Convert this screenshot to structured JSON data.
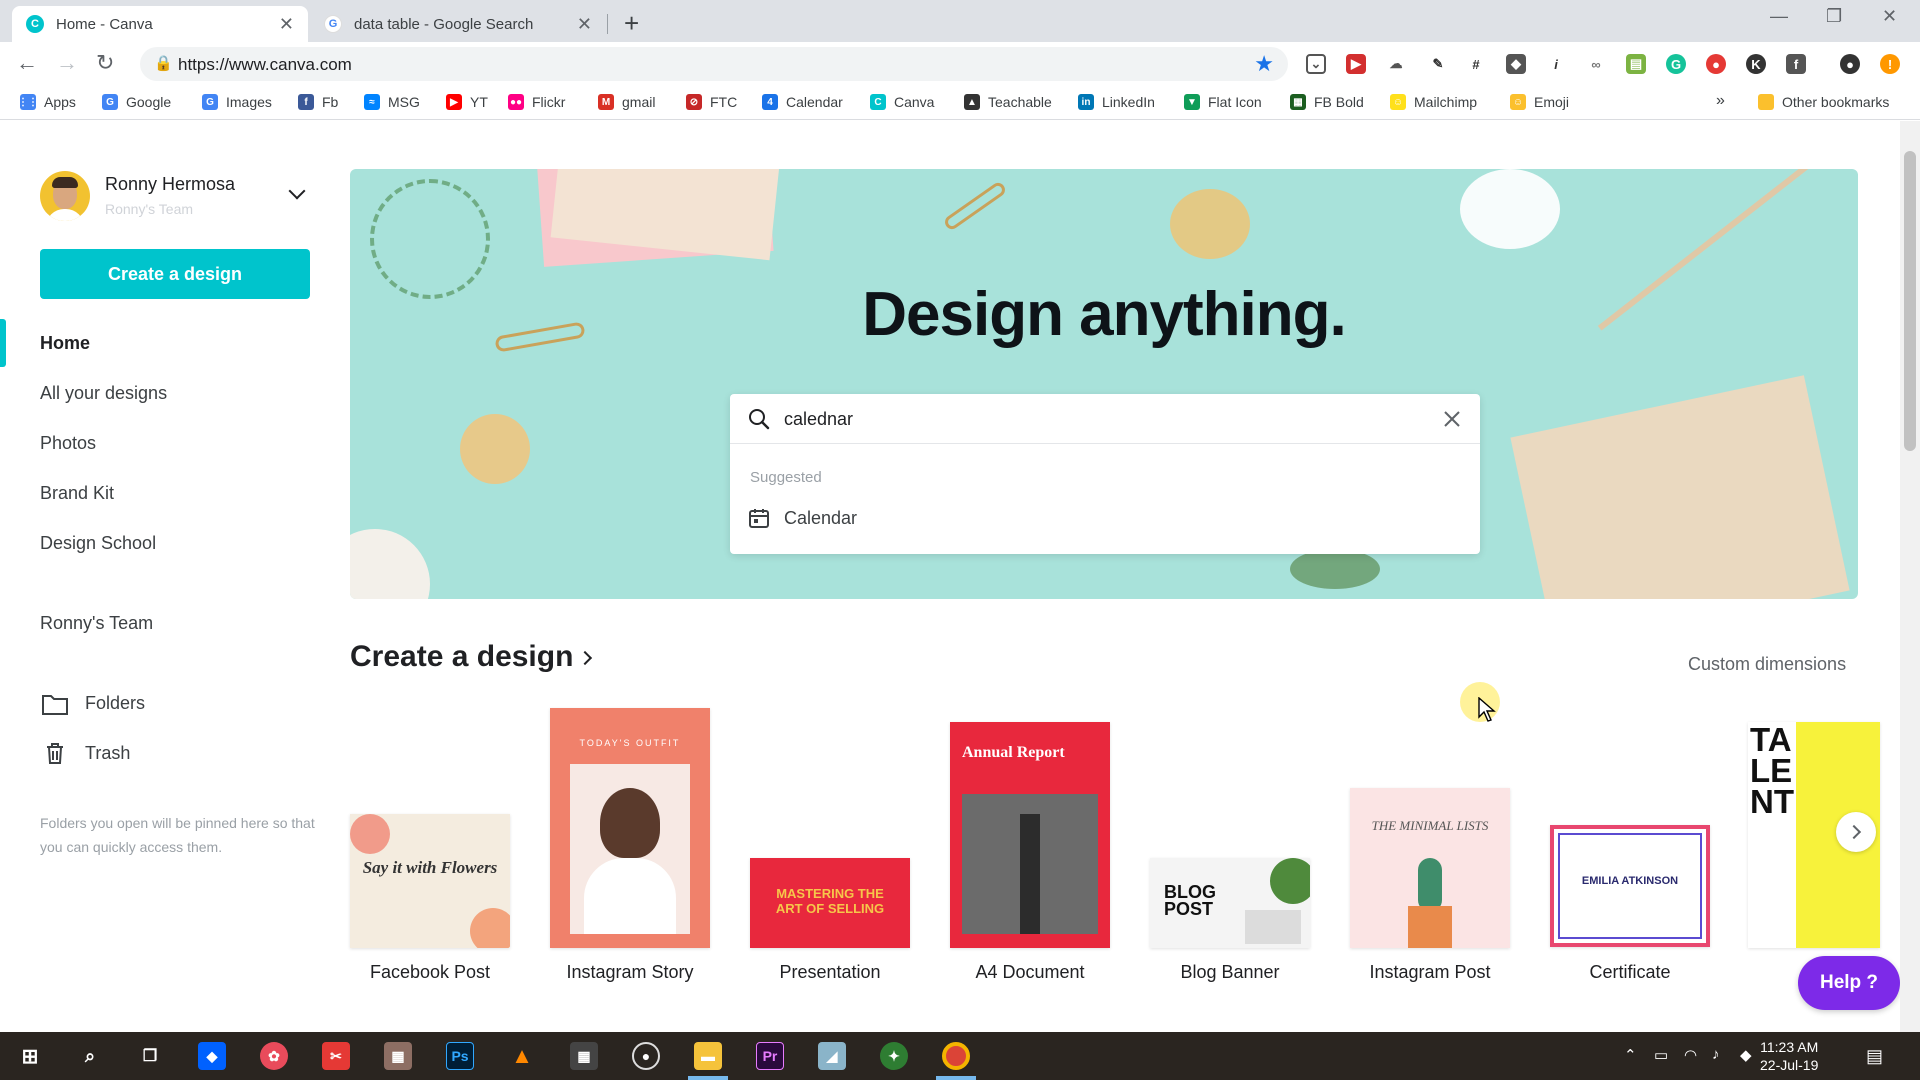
{
  "browser": {
    "tabs": [
      {
        "title": "Home - Canva",
        "active": true,
        "favicon": "canva-icon"
      },
      {
        "title": "data table - Google Search",
        "active": false,
        "favicon": "google-icon"
      }
    ],
    "url": "https://www.canva.com",
    "bookmarks": [
      {
        "label": "Apps",
        "icon": "apps-grid-icon",
        "color": "#4285f4"
      },
      {
        "label": "Google",
        "icon": "google-icon",
        "color": "#4285f4"
      },
      {
        "label": "Images",
        "icon": "google-icon",
        "color": "#4285f4"
      },
      {
        "label": "Fb",
        "icon": "facebook-icon",
        "color": "#3b5998"
      },
      {
        "label": "MSG",
        "icon": "messenger-icon",
        "color": "#0084ff"
      },
      {
        "label": "YT",
        "icon": "youtube-icon",
        "color": "#ff0000"
      },
      {
        "label": "Flickr",
        "icon": "flickr-icon",
        "color": "#ff0084"
      },
      {
        "label": "gmail",
        "icon": "gmail-icon",
        "color": "#d93025"
      },
      {
        "label": "FTC",
        "icon": "ftc-icon",
        "color": "#c62828"
      },
      {
        "label": "Calendar",
        "icon": "calendar-icon",
        "color": "#1a73e8"
      },
      {
        "label": "Canva",
        "icon": "canva-icon",
        "color": "#00c4cc"
      },
      {
        "label": "Teachable",
        "icon": "teachable-icon",
        "color": "#333333"
      },
      {
        "label": "LinkedIn",
        "icon": "linkedin-icon",
        "color": "#0077b5"
      },
      {
        "label": "Flat Icon",
        "icon": "flaticon-icon",
        "color": "#0f9d58"
      },
      {
        "label": "FB Bold",
        "icon": "fb-bold-icon",
        "color": "#1b5e20"
      },
      {
        "label": "Mailchimp",
        "icon": "mailchimp-icon",
        "color": "#ffe01b"
      },
      {
        "label": "Emoji",
        "icon": "emoji-icon",
        "color": "#fbc02d"
      }
    ],
    "bookmarks_overflow": "»",
    "other_bookmarks": "Other bookmarks"
  },
  "user": {
    "name": "Ronny Hermosa",
    "team": "Ronny's Team"
  },
  "sidebar": {
    "create_label": "Create a design",
    "nav": [
      {
        "label": "Home",
        "active": true
      },
      {
        "label": "All your designs",
        "active": false
      },
      {
        "label": "Photos",
        "active": false
      },
      {
        "label": "Brand Kit",
        "active": false
      },
      {
        "label": "Design School",
        "active": false
      }
    ],
    "team_label": "Ronny's Team",
    "folders_label": "Folders",
    "trash_label": "Trash",
    "note": "Folders you open will be pinned here so that you can quickly access them."
  },
  "hero": {
    "title": "Design anything.",
    "search_value": "calednar",
    "suggested_label": "Suggested",
    "suggestion": "Calendar"
  },
  "designs": {
    "title": "Create a design",
    "custom_dimensions": "Custom dimensions",
    "cards": [
      {
        "label": "Facebook Post",
        "thumb_text": "Say it with Flowers"
      },
      {
        "label": "Instagram Story",
        "thumb_text": "TODAY'S OUTFIT"
      },
      {
        "label": "Presentation",
        "thumb_text": "MASTERING THE ART OF SELLING"
      },
      {
        "label": "A4 Document",
        "thumb_text": "Annual Report"
      },
      {
        "label": "Blog Banner",
        "thumb_text": "BLOG POST"
      },
      {
        "label": "Instagram Post",
        "thumb_text": "THE MINIMAL LISTS"
      },
      {
        "label": "Certificate",
        "thumb_text": "EMILIA ATKINSON"
      },
      {
        "label": "",
        "thumb_text": "TA LE NT"
      }
    ],
    "help_label": "Help ?"
  },
  "taskbar": {
    "time": "11:23 AM",
    "date": "22-Jul-19"
  },
  "colors": {
    "accent": "#00c4cc",
    "hero_bg": "#a8e2da",
    "help": "#7d2ae8"
  }
}
